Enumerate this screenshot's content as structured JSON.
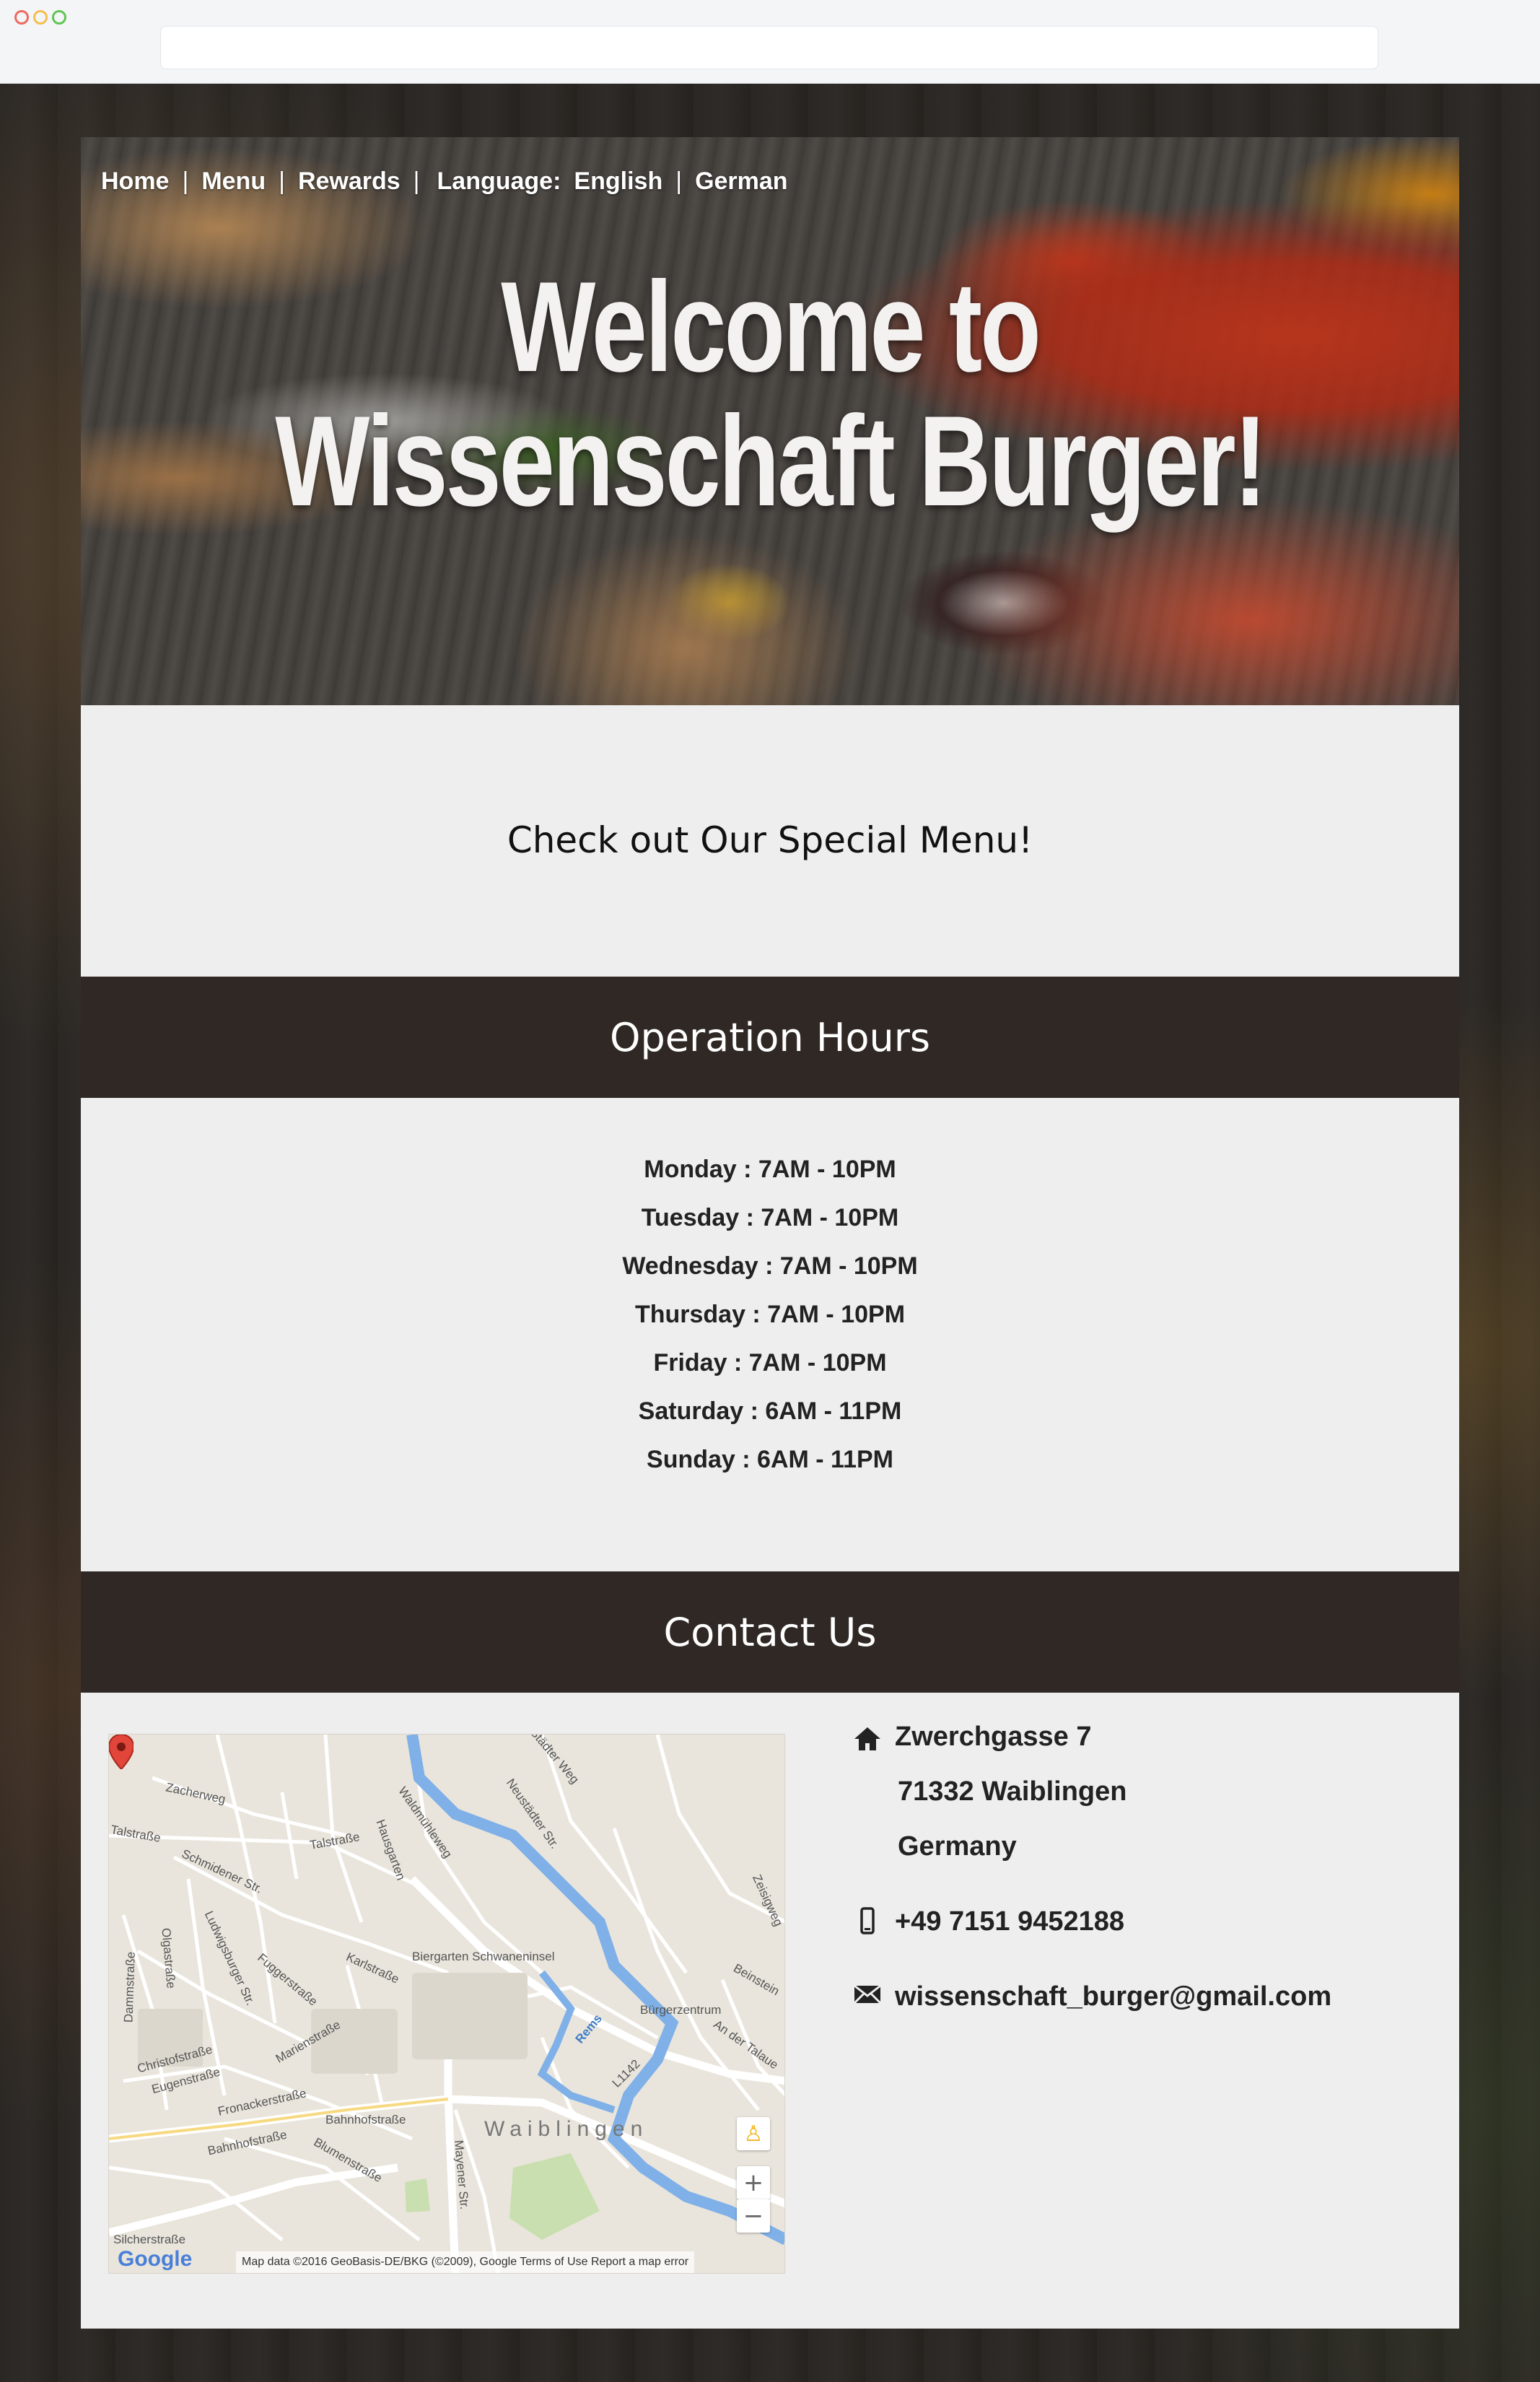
{
  "nav": {
    "home": "Home",
    "menu": "Menu",
    "rewards": "Rewards",
    "language_label": "Language:",
    "english": "English",
    "german": "German",
    "separator": "|"
  },
  "hero": {
    "title_line1": "Welcome to",
    "title_line2": "Wissenschaft Burger!"
  },
  "special": {
    "text": "Check out Our Special Menu!"
  },
  "hours": {
    "heading": "Operation Hours",
    "rows": [
      "Monday : 7AM - 10PM",
      "Tuesday : 7AM - 10PM",
      "Wednesday : 7AM - 10PM",
      "Thursday : 7AM - 10PM",
      "Friday : 7AM - 10PM",
      "Saturday : 6AM - 11PM",
      "Sunday : 6AM - 11PM"
    ]
  },
  "contact": {
    "heading": "Contact Us",
    "address_line1": "Zwerchgasse 7",
    "address_line2": "71332 Waiblingen",
    "address_line3": "Germany",
    "phone": "+49 7151 9452188",
    "email": "wissenschaft_burger@gmail.com"
  },
  "map": {
    "town": "Waiblingen",
    "labels": {
      "zacherweg": "Zacherweg",
      "talstrasse1": "Talstraße",
      "talstrasse2": "Talstraße",
      "schmidener": "Schmidener Str.",
      "hausgarten": "Hausgarten",
      "waldmuhleweg": "Waldmühleweg",
      "neustadter": "Neustädter Str.",
      "stadter_weg": "Städter Weg",
      "fuggerstrasse": "Fuggerstraße",
      "karlstrasse": "Karlstraße",
      "schwaneninsel": "Biergarten Schwaneninsel",
      "burgerzentrum": "Bürgerzentrum",
      "ludwigsburger": "Ludwigsburger Str.",
      "olgastrasse": "Olgastraße",
      "dammstrasse": "Dammstraße",
      "christofstrasse": "Christofstraße",
      "eugenstrasse": "Eugenstraße",
      "marienstrasse": "Marienstraße",
      "fronackerstrasse": "Fronackerstraße",
      "bahnhofstrasse1": "Bahnhofstraße",
      "bahnhofstrasse2": "Bahnhofstraße",
      "blumenstrasse": "Blumenstraße",
      "mayener": "Mayener Str.",
      "rems": "Rems",
      "l1142": "L1142",
      "an_der_talaue": "An der Talaue",
      "beinstein": "Beinstein",
      "zeisigweg": "Zeisigweg",
      "silcherstrasse": "Silcherstraße"
    },
    "zoom_in": "+",
    "zoom_out": "−",
    "google": "Google",
    "attribution": "Map data ©2016 GeoBasis-DE/BKG (©2009), Google   Terms of Use   Report a map error"
  },
  "colors": {
    "band": "#2f2825",
    "panel": "#efeeee",
    "backdrop": "#2a2623"
  },
  "icons": {
    "address": "home-icon",
    "phone": "mobile-phone-icon",
    "email": "envelope-icon"
  }
}
